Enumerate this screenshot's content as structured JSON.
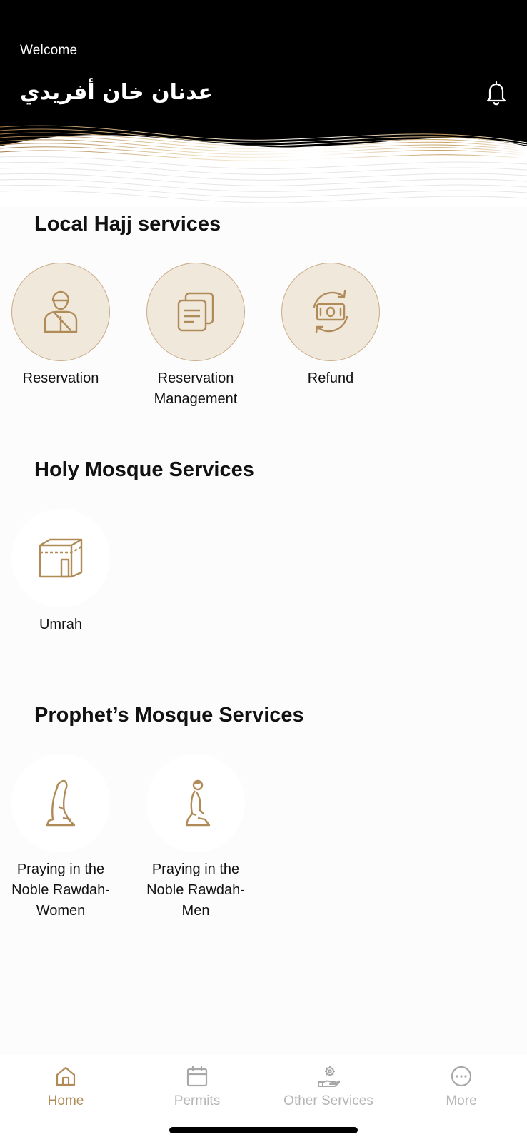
{
  "header": {
    "welcome": "Welcome",
    "user_name": "عدنان خان أفريدي",
    "bell_icon": "bell-icon"
  },
  "sections": {
    "local_hajj": {
      "title": "Local Hajj services",
      "items": [
        {
          "label": "Reservation",
          "icon": "pilgrim-icon"
        },
        {
          "label": "Reservation Management",
          "icon": "documents-icon"
        },
        {
          "label": "Refund",
          "icon": "money-refund-icon"
        }
      ]
    },
    "holy_mosque": {
      "title": "Holy Mosque Services",
      "items": [
        {
          "label": "Umrah",
          "icon": "kaaba-icon"
        }
      ]
    },
    "prophets_mosque": {
      "title": "Prophet’s Mosque Services",
      "items": [
        {
          "label": "Praying in the Noble Rawdah-Women",
          "icon": "praying-woman-icon"
        },
        {
          "label": "Praying in the Noble Rawdah-Men",
          "icon": "praying-man-icon"
        }
      ]
    }
  },
  "bottom_nav": {
    "items": [
      {
        "label": "Home",
        "icon": "home-icon",
        "active": true
      },
      {
        "label": "Permits",
        "icon": "calendar-icon",
        "active": false
      },
      {
        "label": "Other Services",
        "icon": "gear-hand-icon",
        "active": false
      },
      {
        "label": "More",
        "icon": "more-dots-icon",
        "active": false
      }
    ]
  },
  "colors": {
    "accent": "#b08b57",
    "circle_fill": "#f1e8dc",
    "header_bg": "#000000",
    "inactive_nav": "#b5b5b5"
  }
}
